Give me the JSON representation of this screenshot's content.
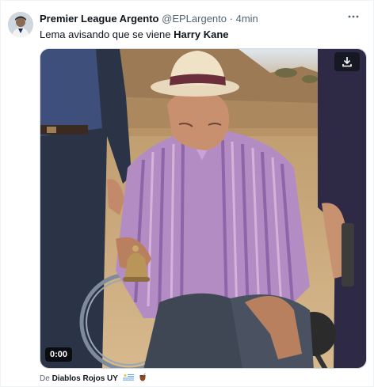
{
  "tweet": {
    "author_name": "Premier League Argento",
    "handle": "@EPLargento",
    "separator": "·",
    "time": "4min",
    "text_prefix": "Lema avisando que se viene ",
    "text_bold": "Harry Kane"
  },
  "media": {
    "timecode": "0:00",
    "download_icon": "download-icon"
  },
  "attribution": {
    "prefix": "De",
    "source": "Diablos Rojos UY",
    "icons": [
      "uruguay-flag-icon",
      "mate-icon"
    ]
  },
  "icons": {
    "more": "more-options-icon"
  }
}
